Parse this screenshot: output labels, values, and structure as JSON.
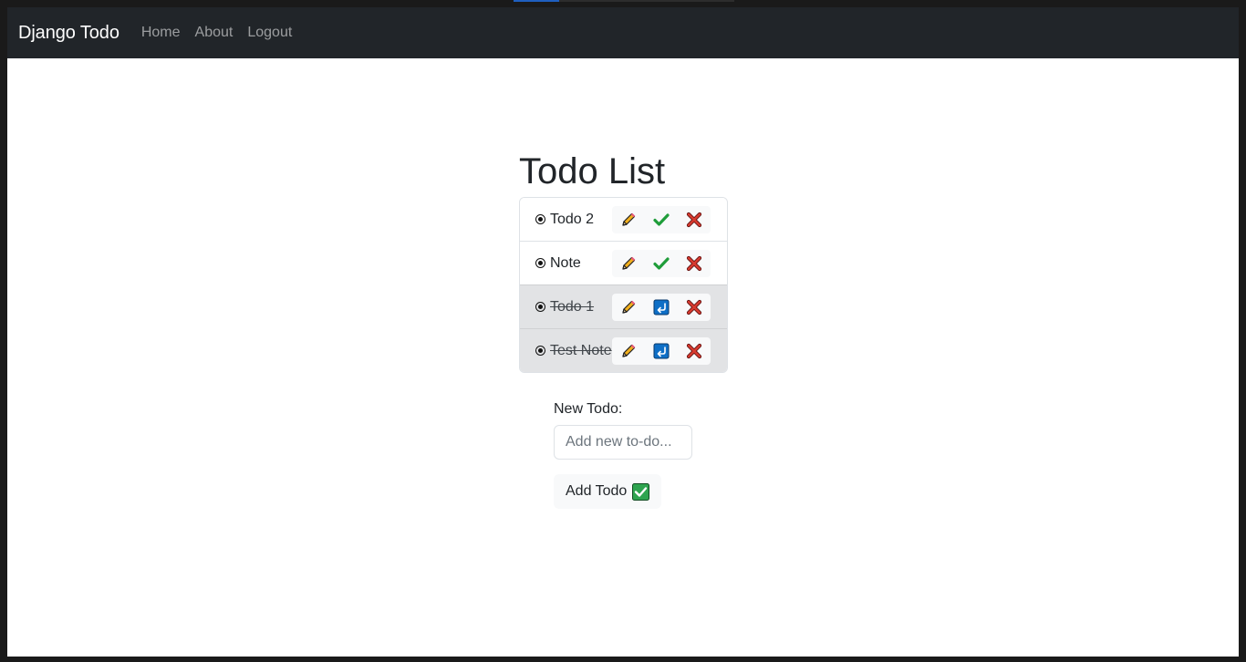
{
  "navbar": {
    "brand": "Django Todo",
    "links": [
      "Home",
      "About",
      "Logout"
    ]
  },
  "page": {
    "title": "Todo List"
  },
  "todos": [
    {
      "text": "Todo 2",
      "completed": false,
      "actions": [
        "edit-icon",
        "complete-check-icon",
        "delete-x-icon"
      ]
    },
    {
      "text": "Note",
      "completed": false,
      "actions": [
        "edit-icon",
        "complete-check-icon",
        "delete-x-icon"
      ]
    },
    {
      "text": "Todo 1",
      "completed": true,
      "actions": [
        "edit-icon",
        "undo-return-icon",
        "delete-x-icon"
      ]
    },
    {
      "text": "Test Note",
      "completed": true,
      "actions": [
        "edit-icon",
        "undo-return-icon",
        "delete-x-icon"
      ]
    }
  ],
  "form": {
    "label": "New Todo:",
    "placeholder": "Add new to-do...",
    "value": "",
    "submit_label": "Add Todo"
  },
  "colors": {
    "navbar_bg": "#212529",
    "done_row_bg": "#e2e3e5",
    "pencil": "#f2b01e",
    "check_green": "#1f9d3a",
    "delete_red": "#d63a2f",
    "undo_blue": "#0f6fc6",
    "add_check_green": "#2ea44f"
  }
}
